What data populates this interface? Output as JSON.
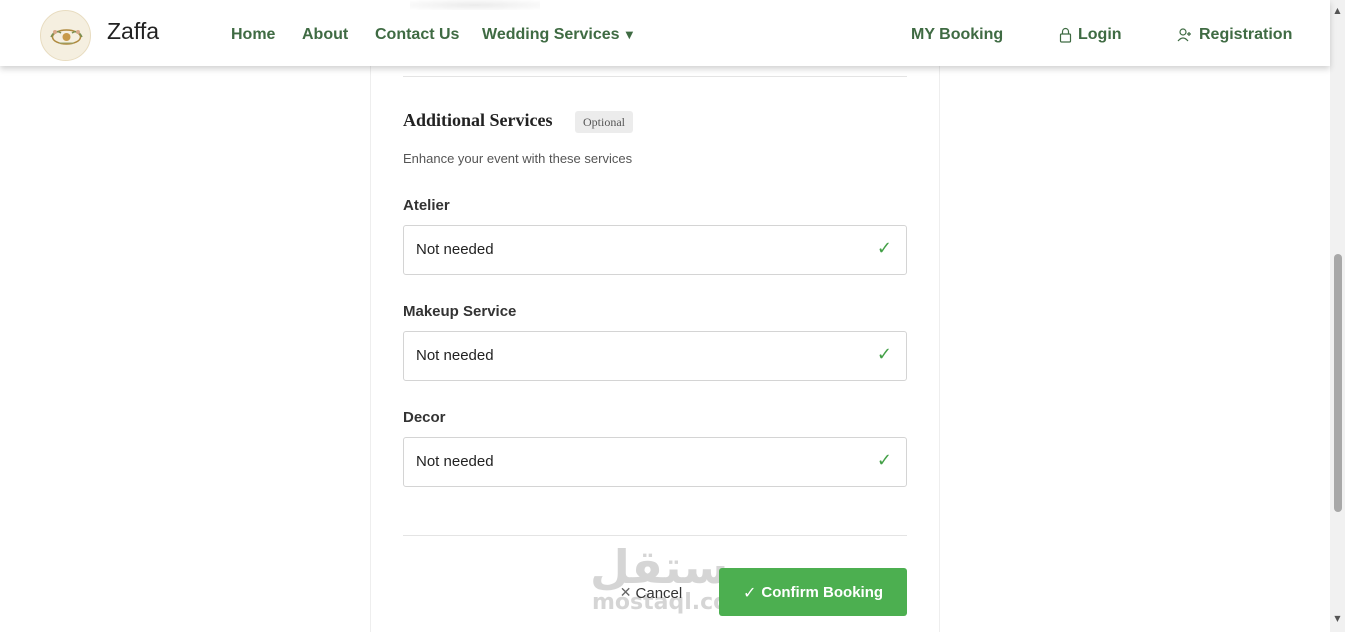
{
  "navbar": {
    "brand": "Zaffa",
    "links": {
      "home": "Home",
      "about": "About",
      "contact": "Contact Us",
      "wedding_services": "Wedding Services",
      "my_booking": "MY Booking",
      "login": "Login",
      "registration": "Registration"
    }
  },
  "additional_services": {
    "title": "Additional Services",
    "badge": "Optional",
    "subtitle": "Enhance your event with these services",
    "fields": [
      {
        "label": "Atelier",
        "value": "Not needed"
      },
      {
        "label": "Makeup Service",
        "value": "Not needed"
      },
      {
        "label": "Decor",
        "value": "Not needed"
      }
    ]
  },
  "actions": {
    "cancel": "Cancel",
    "confirm": "Confirm Booking"
  },
  "watermark": {
    "arabic": "مستقل",
    "latin": "mostaql.com"
  },
  "colors": {
    "nav_link": "#3f6b43",
    "confirm_bg": "#4caf50",
    "check": "#43a047"
  }
}
